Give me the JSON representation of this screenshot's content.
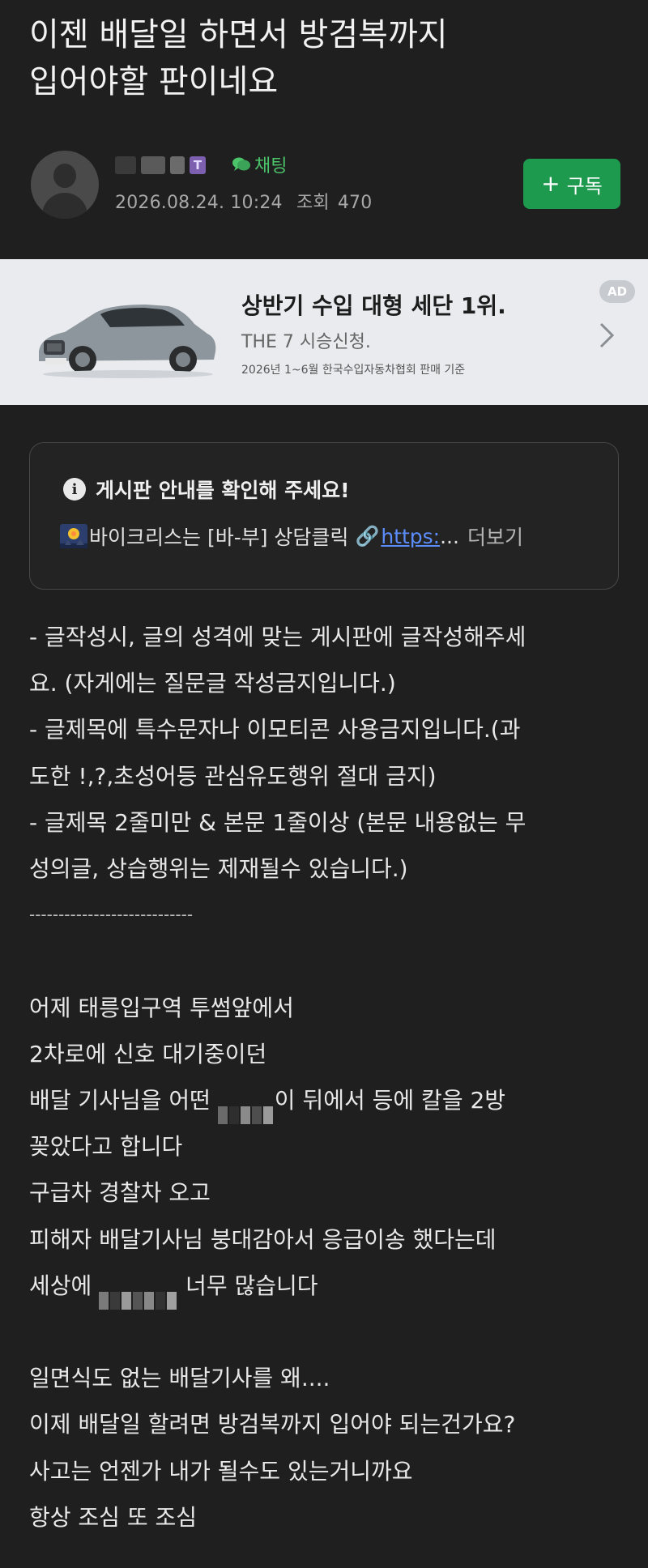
{
  "post": {
    "title_line1": "이젠 배달일 하면서 방검복까지",
    "title_line2": "입어야할 판이네요",
    "category": "채팅",
    "date": "2026.08.24. 10:24",
    "views_label": "조회",
    "views": "470",
    "subscribe_label": "구독"
  },
  "ad": {
    "headline": "상반기 수입 대형 세단 1위.",
    "subline": "THE 7 시승신청.",
    "fine_print": "2026년 1~6월 한국수입자동차협회 판매 기준",
    "badge": "AD"
  },
  "notice": {
    "title": "게시판 안내를 확인해 주세요!",
    "text": "바이크리스는 [바-부] 상담클릭",
    "link_text": "https:",
    "ellipsis": "...",
    "more_label": "더보기"
  },
  "content": {
    "rules": [
      "- 글작성시, 글의 성격에 맞는 게시판에 글작성해주세",
      "요. (자게에는 질문글 작성금지입니다.)",
      "- 글제목에 특수문자나 이모티콘 사용금지입니다.(과",
      "도한 !,?,초성어등 관심유도행위 절대 금지)",
      "- 글제목 2줄미만 & 본문 1줄이상 (본문 내용없는 무",
      "성의글, 상습행위는 제재될수 있습니다.)"
    ],
    "divider": "----------------------------",
    "line1": "어제 태릉입구역 투썸앞에서",
    "line2": "2차로에 신호 대기중이던",
    "line3_before": "배달 기사님을 어떤",
    "line3_after": "이 뒤에서 등에 칼을 2방",
    "line4": "꽂았다고 합니다",
    "line5": "구급차 경찰차 오고",
    "line6": "피해자 배달기사님 붕대감아서 응급이송 했다는데",
    "line7_before": "세상에",
    "line7_after": "너무 많습니다",
    "line8": "일면식도 없는 배달기사를 왜....",
    "line9": "이제 배달일 할려면 방검복까지 입어야 되는건가요?",
    "line10": "사고는 언젠가 내가 될수도 있는거니까요",
    "line11": "항상 조심 또 조심"
  },
  "colors": {
    "background": "#1f1f1f",
    "accent_green": "#1e9a4f",
    "category_green": "#4cc46a",
    "link_blue": "#5c8dff",
    "ad_background": "#e9ebee"
  }
}
